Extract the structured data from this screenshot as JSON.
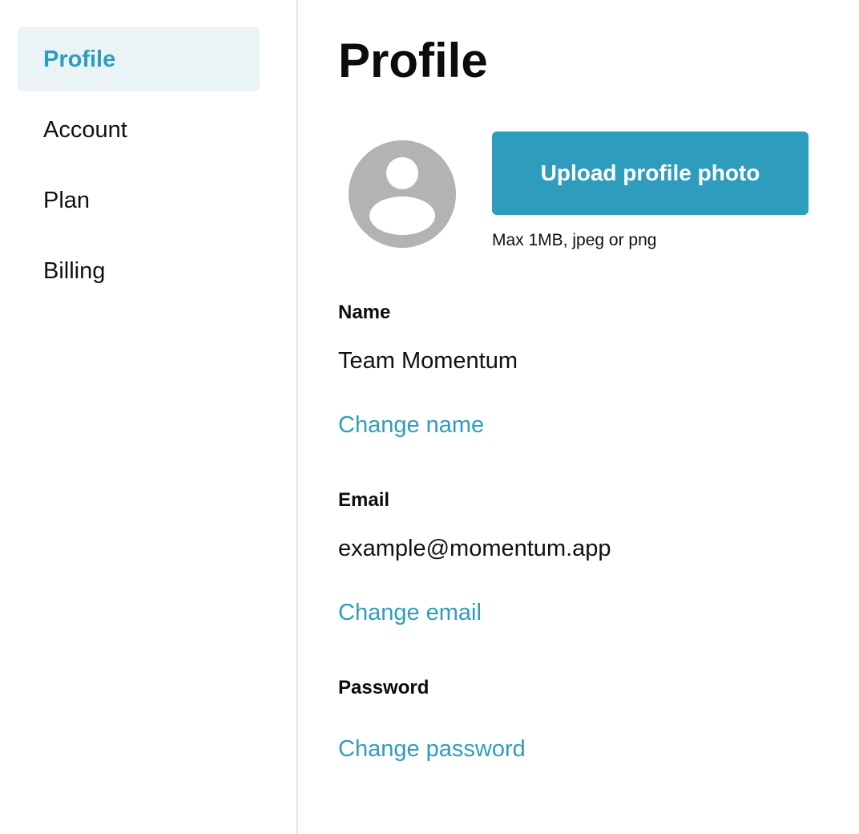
{
  "sidebar": {
    "items": [
      {
        "label": "Profile",
        "active": true
      },
      {
        "label": "Account",
        "active": false
      },
      {
        "label": "Plan",
        "active": false
      },
      {
        "label": "Billing",
        "active": false
      }
    ]
  },
  "main": {
    "title": "Profile",
    "avatar_icon": "user-placeholder-icon",
    "upload_button_label": "Upload profile photo",
    "upload_hint": "Max 1MB, jpeg or png",
    "fields": {
      "name": {
        "label": "Name",
        "value": "Team Momentum",
        "action": "Change name"
      },
      "email": {
        "label": "Email",
        "value": "example@momentum.app",
        "action": "Change email"
      },
      "password": {
        "label": "Password",
        "action": "Change password"
      }
    }
  },
  "colors": {
    "accent": "#2e9dbd",
    "active_nav_background": "#eaf3f6",
    "avatar_placeholder": "#b3b3b3",
    "divider": "#e4e4e4"
  }
}
